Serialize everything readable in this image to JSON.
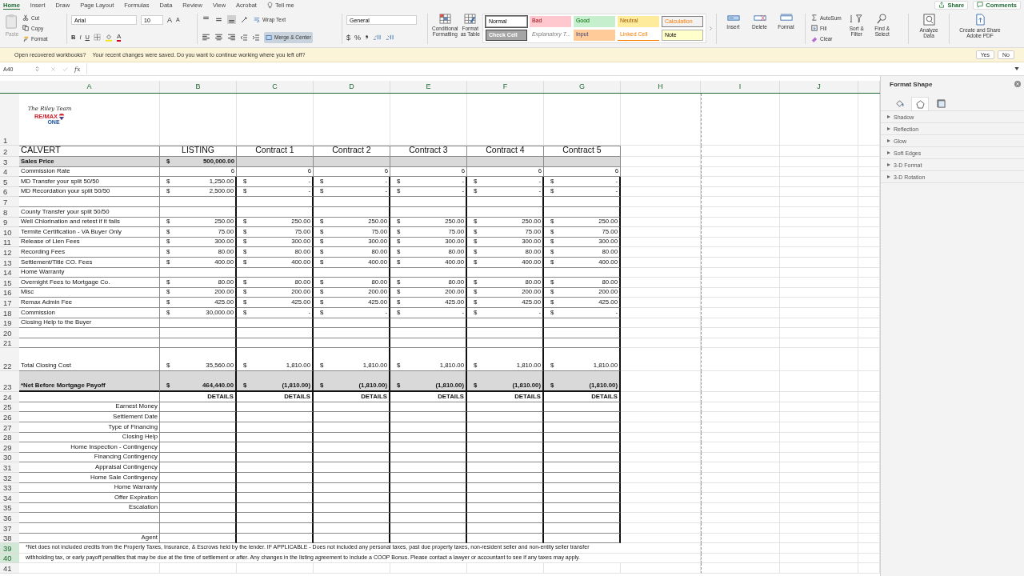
{
  "menu_tabs": [
    {
      "label": "Home",
      "kind": "tab",
      "selected": true
    },
    {
      "label": "Insert",
      "kind": "tab",
      "selected": false
    },
    {
      "label": "Draw",
      "kind": "tab",
      "selected": false
    },
    {
      "label": "Page Layout",
      "kind": "tab",
      "selected": false
    },
    {
      "label": "Formulas",
      "kind": "tab",
      "selected": false
    },
    {
      "label": "Data",
      "kind": "tab",
      "selected": false
    },
    {
      "label": "Review",
      "kind": "tab",
      "selected": false
    },
    {
      "label": "View",
      "kind": "tab",
      "selected": false
    },
    {
      "label": "Acrobat",
      "kind": "tab",
      "selected": false
    },
    {
      "label": "Tell me",
      "kind": "tellme",
      "selected": false
    }
  ],
  "header_buttons": [
    {
      "label": "Share",
      "kind": "share"
    },
    {
      "label": "Comments",
      "kind": "comments"
    }
  ],
  "ribbon": {
    "clipboard": {
      "paste": "Paste",
      "cut": "Cut",
      "copy": "Copy",
      "format": "Format"
    },
    "font": {
      "name": "Arial",
      "size": "10",
      "grow": "A",
      "shrink": "A",
      "bold": "B",
      "italic": "I",
      "underline": "U",
      "font_color": "A"
    },
    "alignment": {
      "vertical": [
        {
          "selected": false
        },
        {
          "selected": false
        },
        {
          "selected": true
        }
      ],
      "horizontal": [
        {
          "selected": false
        },
        {
          "selected": false
        },
        {
          "selected": false
        }
      ],
      "wrap_text": "Wrap Text",
      "merge": {
        "label": "Merge & Center",
        "on": true
      }
    },
    "number": {
      "format": "General",
      "currency": "$",
      "percent": "%"
    },
    "styles": {
      "conditional": [
        "Conditional",
        "Formatting"
      ],
      "format_table": [
        "Format",
        "as Table"
      ],
      "gallery": [
        {
          "label": "Normal",
          "kind": "normal",
          "selected": true
        },
        {
          "label": "Bad",
          "kind": "bad",
          "selected": false
        },
        {
          "label": "Good",
          "kind": "good",
          "selected": false
        },
        {
          "label": "Neutral",
          "kind": "neutral",
          "selected": false
        },
        {
          "label": "Calculation",
          "kind": "calculation",
          "selected": false
        },
        {
          "label": "Check Cell",
          "kind": "check",
          "selected": false
        },
        {
          "label": "Explanatory T...",
          "kind": "explanatory",
          "selected": false
        },
        {
          "label": "Input",
          "kind": "input",
          "selected": false
        },
        {
          "label": "Linked Cell",
          "kind": "linked",
          "selected": false
        },
        {
          "label": "Note",
          "kind": "note",
          "selected": false
        }
      ]
    },
    "cells": [
      {
        "label": "Insert",
        "kind": "insert"
      },
      {
        "label": "Delete",
        "kind": "delete"
      },
      {
        "label": "Format",
        "kind": "format"
      }
    ],
    "editing": {
      "autosum": "AutoSum",
      "fill": "Fill",
      "clear": "Clear",
      "sort": [
        "Sort &",
        "Filter"
      ],
      "find": [
        "Find &",
        "Select"
      ]
    },
    "analyze": [
      "Analyze",
      "Data"
    ],
    "pdf": [
      "Create and Share",
      "Adobe PDF"
    ]
  },
  "message_bar": {
    "title": "Open recovered workbooks?",
    "text": "Your recent changes were saved. Do you want to continue working where you left off?",
    "buttons": [
      "Yes",
      "No"
    ]
  },
  "formula_bar": {
    "name_box": "A40",
    "function_label": "fx"
  },
  "sheet": {
    "columns": [
      "A",
      "B",
      "C",
      "D",
      "E",
      "F",
      "G",
      "H",
      "I",
      "J"
    ],
    "logo": {
      "script": "The Riley Team",
      "brand": "RE/MAX",
      "sub": "ONE"
    },
    "rows": [
      {
        "number": "1",
        "kind": "logo",
        "selected": false
      },
      {
        "number": "2",
        "kind": "header",
        "selected": false,
        "cells": [
          {
            "kind": "text",
            "text": "CALVERT"
          },
          {
            "kind": "text",
            "text": "LISTING"
          },
          {
            "kind": "text",
            "text": "Contract 1"
          },
          {
            "kind": "text",
            "text": "Contract 2"
          },
          {
            "kind": "text",
            "text": "Contract 3"
          },
          {
            "kind": "text",
            "text": "Contract 4"
          },
          {
            "kind": "text",
            "text": "Contract 5"
          }
        ]
      },
      {
        "number": "3",
        "kind": "shaded",
        "selected": false,
        "cells": [
          {
            "kind": "text",
            "text": "Sales Price"
          },
          {
            "kind": "money",
            "symbol": "$",
            "amount": "500,000.00"
          }
        ]
      },
      {
        "number": "4",
        "kind": "plain",
        "selected": false,
        "cells": [
          {
            "kind": "text",
            "text": "Commission Rate"
          },
          {
            "kind": "number",
            "text": "6"
          },
          {
            "kind": "number",
            "text": "6"
          },
          {
            "kind": "number",
            "text": "6"
          },
          {
            "kind": "number",
            "text": "6"
          },
          {
            "kind": "number",
            "text": "6"
          },
          {
            "kind": "number",
            "text": "6"
          }
        ]
      },
      {
        "number": "5",
        "kind": "item",
        "selected": false,
        "cells": [
          {
            "kind": "text",
            "text": "MD Transfer your split 50/50"
          },
          {
            "kind": "money",
            "symbol": "$",
            "amount": "1,250.00"
          },
          {
            "kind": "money",
            "symbol": "$",
            "amount": "-"
          },
          {
            "kind": "money",
            "symbol": "$",
            "amount": "-"
          },
          {
            "kind": "money",
            "symbol": "$",
            "amount": "-"
          },
          {
            "kind": "money",
            "symbol": "$",
            "amount": "-"
          },
          {
            "kind": "money",
            "symbol": "$",
            "amount": "-"
          }
        ]
      },
      {
        "number": "6",
        "kind": "item",
        "selected": false,
        "cells": [
          {
            "kind": "text",
            "text": "MD Recordation your split 50/50"
          },
          {
            "kind": "money",
            "symbol": "$",
            "amount": "2,500.00"
          },
          {
            "kind": "money",
            "symbol": "$",
            "amount": "-"
          },
          {
            "kind": "money",
            "symbol": "$",
            "amount": "-"
          },
          {
            "kind": "money",
            "symbol": "$",
            "amount": "-"
          },
          {
            "kind": "money",
            "symbol": "$",
            "amount": "-"
          },
          {
            "kind": "money",
            "symbol": "$",
            "amount": "-"
          }
        ]
      },
      {
        "number": "7",
        "kind": "item",
        "selected": false
      },
      {
        "number": "8",
        "kind": "item",
        "selected": false,
        "cells": [
          {
            "kind": "text",
            "text": "County Transfer your split 50/50"
          }
        ]
      },
      {
        "number": "9",
        "kind": "item",
        "selected": false,
        "cells": [
          {
            "kind": "text",
            "text": "Well Chlorination and retest if it fails"
          },
          {
            "kind": "money",
            "symbol": "$",
            "amount": "250.00"
          },
          {
            "kind": "money",
            "symbol": "$",
            "amount": "250.00"
          },
          {
            "kind": "money",
            "symbol": "$",
            "amount": "250.00"
          },
          {
            "kind": "money",
            "symbol": "$",
            "amount": "250.00"
          },
          {
            "kind": "money",
            "symbol": "$",
            "amount": "250.00"
          },
          {
            "kind": "money",
            "symbol": "$",
            "amount": "250.00"
          }
        ]
      },
      {
        "number": "10",
        "kind": "item",
        "selected": false,
        "cells": [
          {
            "kind": "text",
            "text": "Termite Certification - VA Buyer Only"
          },
          {
            "kind": "money",
            "symbol": "$",
            "amount": "75.00"
          },
          {
            "kind": "money",
            "symbol": "$",
            "amount": "75.00"
          },
          {
            "kind": "money",
            "symbol": "$",
            "amount": "75.00"
          },
          {
            "kind": "money",
            "symbol": "$",
            "amount": "75.00"
          },
          {
            "kind": "money",
            "symbol": "$",
            "amount": "75.00"
          },
          {
            "kind": "money",
            "symbol": "$",
            "amount": "75.00"
          }
        ]
      },
      {
        "number": "11",
        "kind": "item",
        "selected": false,
        "cells": [
          {
            "kind": "text",
            "text": "Release of Lien Fees"
          },
          {
            "kind": "money",
            "symbol": "$",
            "amount": "300.00"
          },
          {
            "kind": "money",
            "symbol": "$",
            "amount": "300.00"
          },
          {
            "kind": "money",
            "symbol": "$",
            "amount": "300.00"
          },
          {
            "kind": "money",
            "symbol": "$",
            "amount": "300.00"
          },
          {
            "kind": "money",
            "symbol": "$",
            "amount": "300.00"
          },
          {
            "kind": "money",
            "symbol": "$",
            "amount": "300.00"
          }
        ]
      },
      {
        "number": "12",
        "kind": "item",
        "selected": false,
        "cells": [
          {
            "kind": "text",
            "text": "Recording Fees"
          },
          {
            "kind": "money",
            "symbol": "$",
            "amount": "80.00"
          },
          {
            "kind": "money",
            "symbol": "$",
            "amount": "80.00"
          },
          {
            "kind": "money",
            "symbol": "$",
            "amount": "80.00"
          },
          {
            "kind": "money",
            "symbol": "$",
            "amount": "80.00"
          },
          {
            "kind": "money",
            "symbol": "$",
            "amount": "80.00"
          },
          {
            "kind": "money",
            "symbol": "$",
            "amount": "80.00"
          }
        ]
      },
      {
        "number": "13",
        "kind": "item",
        "selected": false,
        "cells": [
          {
            "kind": "text",
            "text": "Settlement/Title CO. Fees"
          },
          {
            "kind": "money",
            "symbol": "$",
            "amount": "400.00"
          },
          {
            "kind": "money",
            "symbol": "$",
            "amount": "400.00"
          },
          {
            "kind": "money",
            "symbol": "$",
            "amount": "400.00"
          },
          {
            "kind": "money",
            "symbol": "$",
            "amount": "400.00"
          },
          {
            "kind": "money",
            "symbol": "$",
            "amount": "400.00"
          },
          {
            "kind": "money",
            "symbol": "$",
            "amount": "400.00"
          }
        ]
      },
      {
        "number": "14",
        "kind": "item",
        "selected": false,
        "cells": [
          {
            "kind": "text",
            "text": "Home Warranty"
          }
        ]
      },
      {
        "number": "15",
        "kind": "item",
        "selected": false,
        "cells": [
          {
            "kind": "text",
            "text": "Overnight Fees to Mortgage Co."
          },
          {
            "kind": "money",
            "symbol": "$",
            "amount": "80.00"
          },
          {
            "kind": "money",
            "symbol": "$",
            "amount": "80.00"
          },
          {
            "kind": "money",
            "symbol": "$",
            "amount": "80.00"
          },
          {
            "kind": "money",
            "symbol": "$",
            "amount": "80.00"
          },
          {
            "kind": "money",
            "symbol": "$",
            "amount": "80.00"
          },
          {
            "kind": "money",
            "symbol": "$",
            "amount": "80.00"
          }
        ]
      },
      {
        "number": "16",
        "kind": "item",
        "selected": false,
        "cells": [
          {
            "kind": "text",
            "text": "Misc"
          },
          {
            "kind": "money",
            "symbol": "$",
            "amount": "200.00"
          },
          {
            "kind": "money",
            "symbol": "$",
            "amount": "200.00"
          },
          {
            "kind": "money",
            "symbol": "$",
            "amount": "200.00"
          },
          {
            "kind": "money",
            "symbol": "$",
            "amount": "200.00"
          },
          {
            "kind": "money",
            "symbol": "$",
            "amount": "200.00"
          },
          {
            "kind": "money",
            "symbol": "$",
            "amount": "200.00"
          }
        ]
      },
      {
        "number": "17",
        "kind": "item",
        "selected": false,
        "cells": [
          {
            "kind": "text",
            "text": "Remax Admin Fee"
          },
          {
            "kind": "money",
            "symbol": "$",
            "amount": "425.00"
          },
          {
            "kind": "money",
            "symbol": "$",
            "amount": "425.00"
          },
          {
            "kind": "money",
            "symbol": "$",
            "amount": "425.00"
          },
          {
            "kind": "money",
            "symbol": "$",
            "amount": "425.00"
          },
          {
            "kind": "money",
            "symbol": "$",
            "amount": "425.00"
          },
          {
            "kind": "money",
            "symbol": "$",
            "amount": "425.00"
          }
        ]
      },
      {
        "number": "18",
        "kind": "item",
        "selected": false,
        "cells": [
          {
            "kind": "text",
            "text": "Commission"
          },
          {
            "kind": "money",
            "symbol": "$",
            "amount": "30,000.00"
          },
          {
            "kind": "money",
            "symbol": "$",
            "amount": "-"
          },
          {
            "kind": "money",
            "symbol": "$",
            "amount": "-"
          },
          {
            "kind": "money",
            "symbol": "$",
            "amount": "-"
          },
          {
            "kind": "money",
            "symbol": "$",
            "amount": "-"
          },
          {
            "kind": "money",
            "symbol": "$",
            "amount": "-"
          }
        ]
      },
      {
        "number": "19",
        "kind": "item",
        "selected": false,
        "cells": [
          {
            "kind": "text",
            "text": "Closing Help to the Buyer"
          }
        ]
      },
      {
        "number": "20",
        "kind": "item",
        "selected": false
      },
      {
        "number": "21",
        "kind": "item",
        "selected": false
      },
      {
        "number": "22",
        "kind": "total",
        "selected": false,
        "cells": [
          {
            "kind": "text",
            "text": "Total Closing Cost"
          },
          {
            "kind": "money",
            "symbol": "$",
            "amount": "35,560.00"
          },
          {
            "kind": "money",
            "symbol": "$",
            "amount": "1,810.00"
          },
          {
            "kind": "money",
            "symbol": "$",
            "amount": "1,810.00"
          },
          {
            "kind": "money",
            "symbol": "$",
            "amount": "1,810.00"
          },
          {
            "kind": "money",
            "symbol": "$",
            "amount": "1,810.00"
          },
          {
            "kind": "money",
            "symbol": "$",
            "amount": "1,810.00"
          }
        ]
      },
      {
        "number": "23",
        "kind": "net",
        "selected": false,
        "cells": [
          {
            "kind": "text",
            "text": "*Net Before Mortgage Payoff"
          },
          {
            "kind": "money",
            "symbol": "$",
            "amount": "464,440.00"
          },
          {
            "kind": "money",
            "symbol": "$",
            "amount": "(1,810.00)"
          },
          {
            "kind": "money",
            "symbol": "$",
            "amount": "(1,810.00)"
          },
          {
            "kind": "money",
            "symbol": "$",
            "amount": "(1,810.00)"
          },
          {
            "kind": "money",
            "symbol": "$",
            "amount": "(1,810.00)"
          },
          {
            "kind": "money",
            "symbol": "$",
            "amount": "(1,810.00)"
          }
        ]
      },
      {
        "number": "24",
        "kind": "details",
        "selected": false,
        "cells": [
          null,
          {
            "kind": "text",
            "text": "DETAILS"
          },
          {
            "kind": "text",
            "text": "DETAILS"
          },
          {
            "kind": "text",
            "text": "DETAILS"
          },
          {
            "kind": "text",
            "text": "DETAILS"
          },
          {
            "kind": "text",
            "text": "DETAILS"
          },
          {
            "kind": "text",
            "text": "DETAILS"
          }
        ]
      },
      {
        "number": "25",
        "kind": "detail",
        "selected": false,
        "cells": [
          {
            "kind": "text",
            "text": "Earnest Money"
          }
        ]
      },
      {
        "number": "26",
        "kind": "detail",
        "selected": false,
        "cells": [
          {
            "kind": "text",
            "text": "Settlement Date"
          }
        ]
      },
      {
        "number": "27",
        "kind": "detail",
        "selected": false,
        "cells": [
          {
            "kind": "text",
            "text": "Type of Financing"
          }
        ]
      },
      {
        "number": "28",
        "kind": "detail",
        "selected": false,
        "cells": [
          {
            "kind": "text",
            "text": "Closing Help"
          }
        ]
      },
      {
        "number": "29",
        "kind": "detail",
        "selected": false,
        "cells": [
          {
            "kind": "text",
            "text": "Home Inspection - Contingency"
          }
        ]
      },
      {
        "number": "30",
        "kind": "detail",
        "selected": false,
        "cells": [
          {
            "kind": "text",
            "text": "Financing Contingency"
          }
        ]
      },
      {
        "number": "31",
        "kind": "detail",
        "selected": false,
        "cells": [
          {
            "kind": "text",
            "text": "Appraisal Contingency"
          }
        ]
      },
      {
        "number": "32",
        "kind": "detail",
        "selected": false,
        "cells": [
          {
            "kind": "text",
            "text": "Home Sale Contingency"
          }
        ]
      },
      {
        "number": "33",
        "kind": "detail",
        "selected": false,
        "cells": [
          {
            "kind": "text",
            "text": "Home Warranty"
          }
        ]
      },
      {
        "number": "34",
        "kind": "detail",
        "selected": false,
        "cells": [
          {
            "kind": "text",
            "text": "Offer Expiration"
          }
        ]
      },
      {
        "number": "35",
        "kind": "detail",
        "selected": false,
        "cells": [
          {
            "kind": "text",
            "text": "Escalation"
          }
        ]
      },
      {
        "number": "36",
        "kind": "detail",
        "selected": false
      },
      {
        "number": "37",
        "kind": "detail",
        "selected": false
      },
      {
        "number": "38",
        "kind": "detail",
        "selected": false,
        "cells": [
          {
            "kind": "text",
            "text": "Agent"
          }
        ]
      },
      {
        "number": "39",
        "kind": "footnote",
        "selected": true,
        "text": "*Net does not included credits from the Property Taxes, Insurance, & Escrows held by the lender. IF APPLICABLE - Does not included any personal taxes, past due property taxes, non-resident seller and non-entity seller transfer"
      },
      {
        "number": "40",
        "kind": "footnote",
        "selected": true,
        "text": "withholding tax, or early payoff penalties that may be due at the time of settlement or after. Any changes in the listing agreement to include a COOP Bonus. Please contact a lawyer or accountant to see if any taxes may apply."
      },
      {
        "number": "41",
        "kind": "empty",
        "selected": false
      }
    ]
  },
  "format_panel": {
    "title": "Format Shape",
    "tabs": [
      {
        "kind": "fill",
        "selected": false
      },
      {
        "kind": "effects",
        "selected": true
      },
      {
        "kind": "size",
        "selected": false
      }
    ],
    "sections": [
      {
        "label": "Shadow",
        "expanded": false
      },
      {
        "label": "Reflection",
        "expanded": false
      },
      {
        "label": "Glow",
        "expanded": false
      },
      {
        "label": "Soft Edges",
        "expanded": false
      },
      {
        "label": "3-D Format",
        "expanded": false
      },
      {
        "label": "3-D Rotation",
        "expanded": false
      }
    ]
  }
}
